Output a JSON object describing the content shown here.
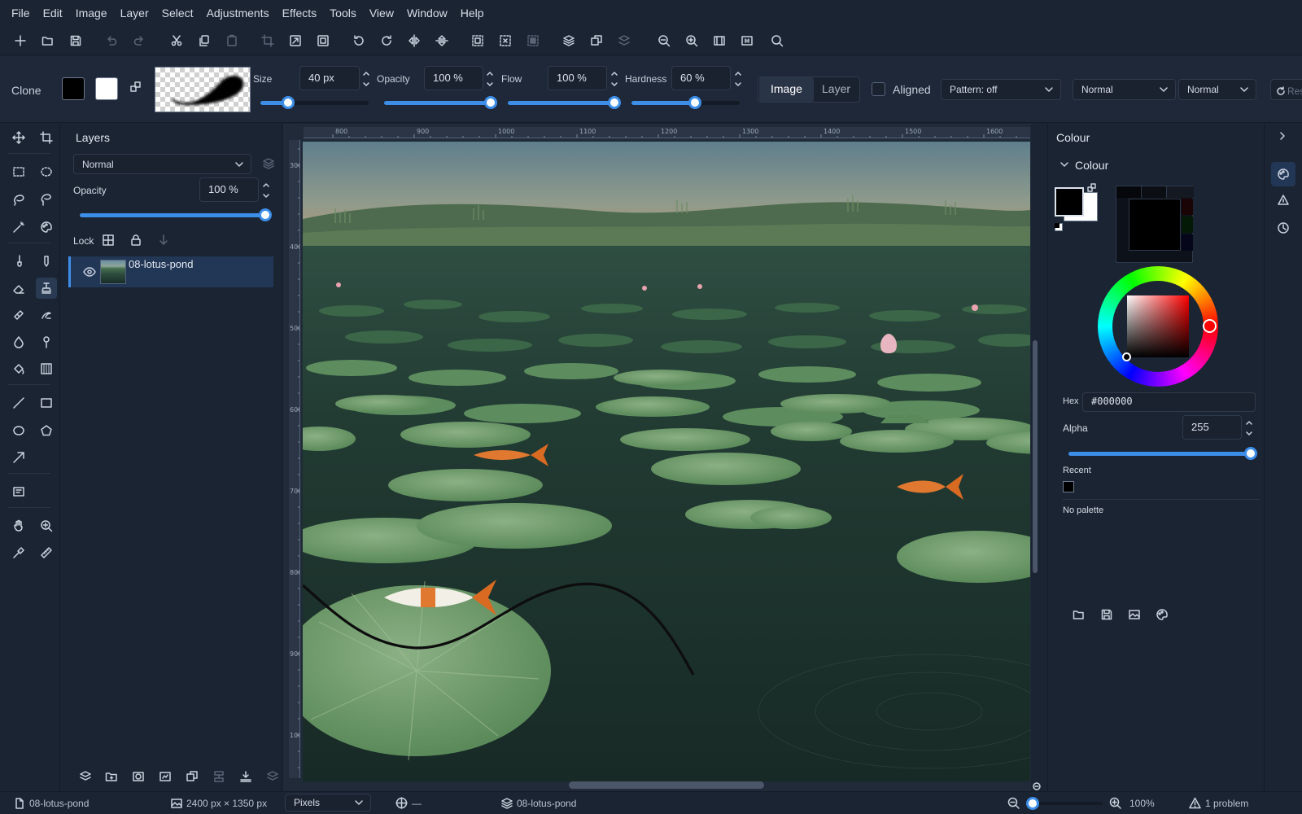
{
  "menu": [
    "File",
    "Edit",
    "Image",
    "Layer",
    "Select",
    "Adjustments",
    "Effects",
    "Tools",
    "View",
    "Window",
    "Help"
  ],
  "toolbar_icons": [
    "new-icon",
    "open-icon",
    "save-icon",
    "undo-icon",
    "redo-icon",
    "cut-icon",
    "copy-icon",
    "paste-icon",
    "crop-icon",
    "resize-image-icon",
    "resize-canvas-icon",
    "rotate-left-icon",
    "rotate-right-icon",
    "flip-horizontal-icon",
    "flip-vertical-icon",
    "select-all-icon",
    "deselect-icon",
    "invert-selection-icon",
    "layers-icon",
    "duplicate-layer-icon",
    "merge-layer-icon",
    "zoom-out-icon",
    "zoom-in-icon",
    "fit-window-icon",
    "actual-size-icon",
    "search-icon"
  ],
  "tool_options": {
    "tool_name": "Clone",
    "size_label": "Size",
    "size_value": "40 px",
    "size_fraction": 0.27,
    "opacity_label": "Opacity",
    "opacity_value": "100 %",
    "opacity_fraction": 1.0,
    "flow_label": "Flow",
    "flow_value": "100 %",
    "flow_fraction": 1.0,
    "hardness_label": "Hardness",
    "hardness_value": "60 %",
    "hardness_fraction": 0.6,
    "source_image": "Image",
    "source_layer": "Layer",
    "aligned_label": "Aligned",
    "aligned_checked": false,
    "pattern_dropdown": "Pattern: off",
    "blend_mode_1": "Normal",
    "blend_mode_2": "Normal",
    "reset_label": "Reset"
  },
  "layers_panel": {
    "title": "Layers",
    "blend_mode": "Normal",
    "opacity_label": "Opacity",
    "opacity_value": "100 %",
    "opacity_fraction": 1.0,
    "lock_label": "Lock",
    "layers": [
      {
        "name": "08-lotus-pond",
        "visible": true
      }
    ]
  },
  "rulers": {
    "top": [
      "800",
      "900",
      "1000",
      "1100",
      "1200",
      "1300",
      "1400",
      "1500",
      "1600"
    ],
    "left": [
      "300",
      "400",
      "500",
      "600",
      "700",
      "800",
      "900",
      "1000"
    ]
  },
  "color_panel": {
    "title": "Colour",
    "section_title": "Colour",
    "primary_color": "#000000",
    "secondary_color": "#ffffff",
    "hex_label": "Hex",
    "hex_value": "#000000",
    "alpha_label": "Alpha",
    "alpha_value": "255",
    "alpha_fraction": 1.0,
    "recent_label": "Recent",
    "recent_colors": [
      "#000000"
    ],
    "palette_label": "No palette",
    "accent_color": "#3d8ee8"
  },
  "status": {
    "document_name": "08-lotus-pond",
    "dimensions": "2400 px × 1350 px",
    "units": "Pixels",
    "cursor_position": "—",
    "active_layer": "08-lotus-pond",
    "zoom": "100%",
    "problems": "1 problem"
  }
}
